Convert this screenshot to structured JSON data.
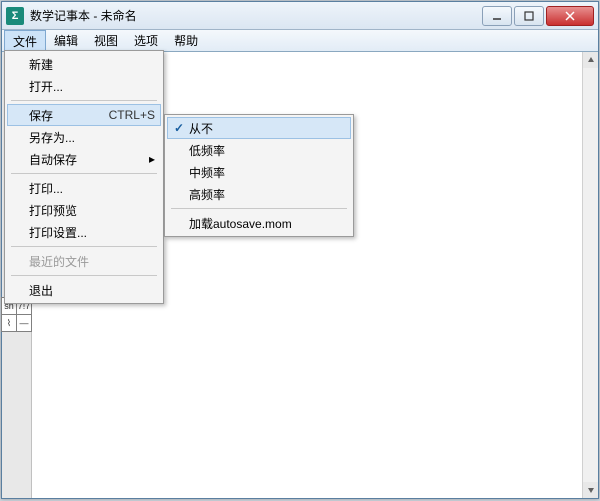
{
  "window": {
    "title": "数学记事本 - 未命名"
  },
  "menubar": {
    "items": [
      "文件",
      "编辑",
      "视图",
      "选项",
      "帮助"
    ]
  },
  "file_menu": {
    "new": "新建",
    "open": "打开...",
    "save": "保存",
    "save_shortcut": "CTRL+S",
    "save_as": "另存为...",
    "autosave": "自动保存",
    "print": "打印...",
    "print_preview": "打印预览",
    "print_setup": "打印设置...",
    "recent": "最近的文件",
    "exit": "退出"
  },
  "autosave_menu": {
    "never": "从不",
    "low": "低频率",
    "mid": "中频率",
    "high": "高频率",
    "load": "加载autosave.mom"
  },
  "toolbar": {
    "cells": [
      "sn",
      "7!7",
      "⌇",
      "—"
    ]
  }
}
